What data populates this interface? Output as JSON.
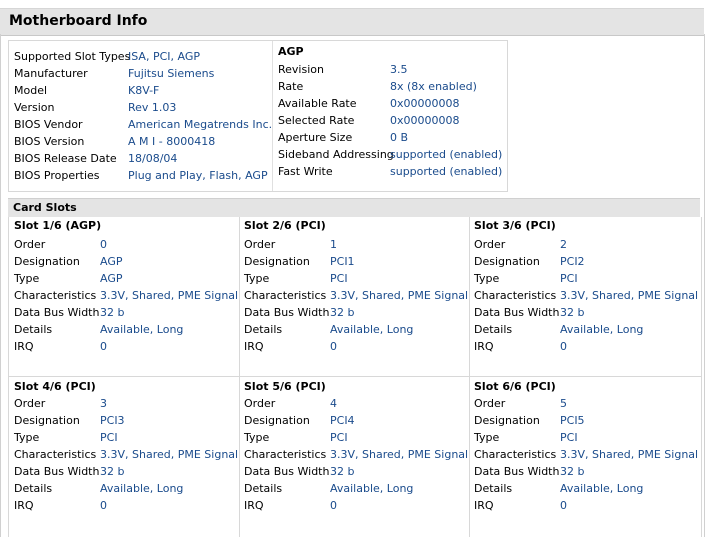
{
  "header": {
    "title": "Motherboard Info"
  },
  "board": [
    {
      "label": "Supported Slot Types",
      "value": "ISA, PCI, AGP"
    },
    {
      "label": "Manufacturer",
      "value": "Fujitsu Siemens"
    },
    {
      "label": "Model",
      "value": "K8V-F"
    },
    {
      "label": "Version",
      "value": "Rev 1.03"
    },
    {
      "label": "BIOS Vendor",
      "value": "American Megatrends Inc."
    },
    {
      "label": "BIOS Version",
      "value": "A M I - 8000418"
    },
    {
      "label": "BIOS Release Date",
      "value": "18/08/04"
    },
    {
      "label": "BIOS Properties",
      "value": "Plug and Play, Flash, AGP"
    }
  ],
  "agp": {
    "title": "AGP",
    "rows": [
      {
        "label": "Revision",
        "value": "3.5"
      },
      {
        "label": "Rate",
        "value": "8x (8x enabled)"
      },
      {
        "label": "Available Rate",
        "value": "0x00000008"
      },
      {
        "label": "Selected Rate",
        "value": "0x00000008"
      },
      {
        "label": "Aperture Size",
        "value": "0 B"
      },
      {
        "label": "Sideband Addressing",
        "value": "supported (enabled)"
      },
      {
        "label": "Fast Write",
        "value": "supported (enabled)"
      }
    ]
  },
  "card_slots": {
    "title": "Card Slots",
    "labels": [
      "Order",
      "Designation",
      "Type",
      "Characteristics",
      "Data Bus Width",
      "Details",
      "IRQ"
    ],
    "slots": [
      {
        "title": "Slot 1/6 (AGP)",
        "values": [
          "0",
          "AGP",
          "AGP",
          "3.3V, Shared, PME Signal",
          "32 b",
          "Available, Long",
          "0"
        ]
      },
      {
        "title": "Slot 2/6 (PCI)",
        "values": [
          "1",
          "PCI1",
          "PCI",
          "3.3V, Shared, PME Signal",
          "32 b",
          "Available, Long",
          "0"
        ]
      },
      {
        "title": "Slot 3/6 (PCI)",
        "values": [
          "2",
          "PCI2",
          "PCI",
          "3.3V, Shared, PME Signal",
          "32 b",
          "Available, Long",
          "0"
        ]
      },
      {
        "title": "Slot 4/6 (PCI)",
        "values": [
          "3",
          "PCI3",
          "PCI",
          "3.3V, Shared, PME Signal",
          "32 b",
          "Available, Long",
          "0"
        ]
      },
      {
        "title": "Slot 5/6 (PCI)",
        "values": [
          "4",
          "PCI4",
          "PCI",
          "3.3V, Shared, PME Signal",
          "32 b",
          "Available, Long",
          "0"
        ]
      },
      {
        "title": "Slot 6/6 (PCI)",
        "values": [
          "5",
          "PCI5",
          "PCI",
          "3.3V, Shared, PME Signal",
          "32 b",
          "Available, Long",
          "0"
        ]
      }
    ]
  }
}
